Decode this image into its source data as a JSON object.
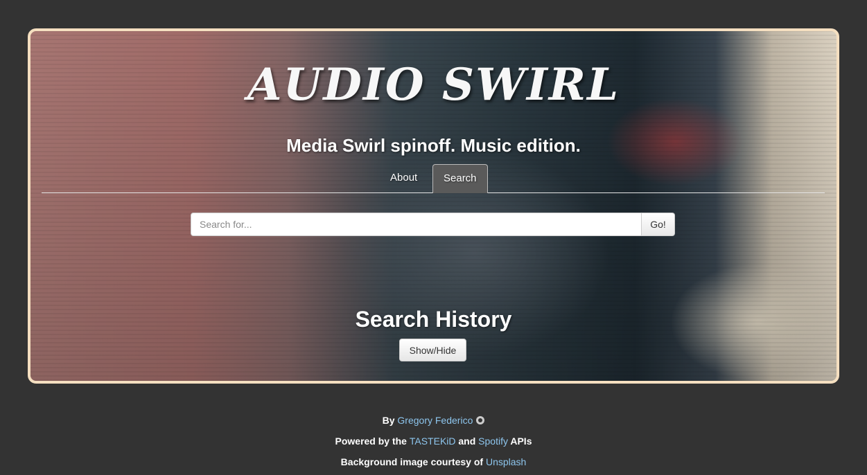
{
  "hero": {
    "title": "AUDIO SWIRL",
    "subtitle": "Media Swirl spinoff. Music edition."
  },
  "tabs": [
    {
      "label": "About",
      "active": false
    },
    {
      "label": "Search",
      "active": true
    }
  ],
  "search": {
    "placeholder": "Search for...",
    "value": "",
    "go_label": "Go!"
  },
  "history": {
    "heading": "Search History",
    "toggle_label": "Show/Hide"
  },
  "footer": {
    "by_prefix": "By",
    "author": "Gregory Federico",
    "powered_prefix": "Powered by the",
    "tastekid": "TASTEKiD",
    "and": "and",
    "spotify": "Spotify",
    "apis": "APIs",
    "bg_prefix": "Background image courtesy of",
    "unsplash": "Unsplash"
  },
  "colors": {
    "page_bg": "#333333",
    "hero_border": "#f5dfc0",
    "link": "#8ec6ee",
    "active_tab_bg": "#5a5a5a"
  },
  "icons": {
    "author_link": "github-icon"
  }
}
